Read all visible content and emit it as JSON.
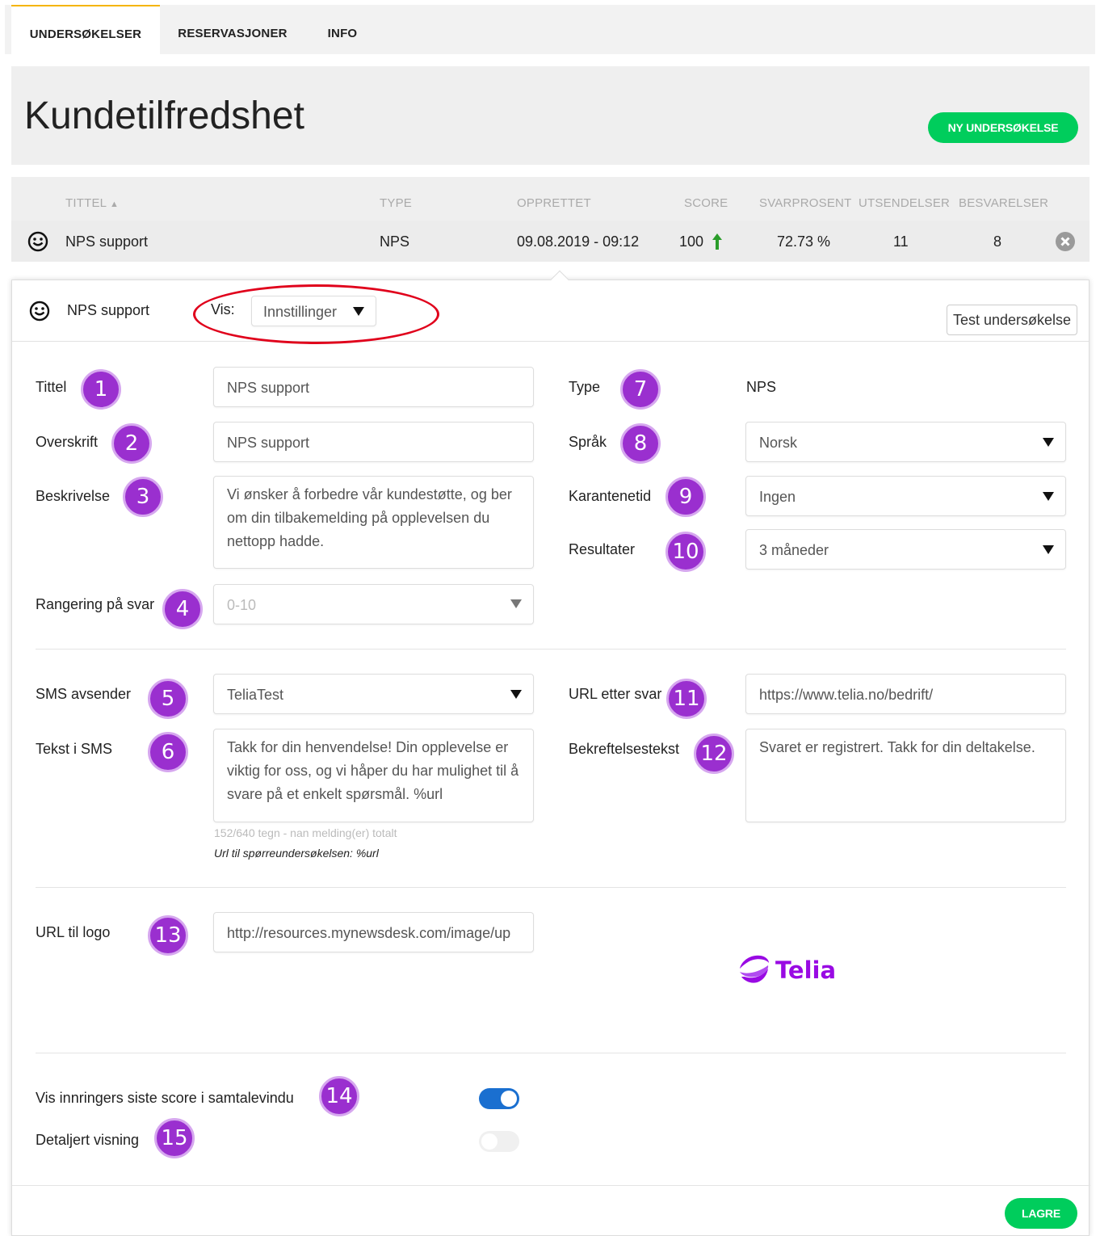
{
  "tabs": [
    {
      "label": "UNDERSØKELSER",
      "active": true
    },
    {
      "label": "RESERVASJONER",
      "active": false
    },
    {
      "label": "INFO",
      "active": false
    }
  ],
  "header": {
    "title": "Kundetilfredshet",
    "new_button": "NY UNDERSØKELSE"
  },
  "table": {
    "columns": [
      "TITTEL",
      "TYPE",
      "OPPRETTET",
      "SCORE",
      "SVARPROSENT",
      "UTSENDELSER",
      "BESVARELSER"
    ],
    "row": {
      "title": "NPS support",
      "type": "NPS",
      "created": "09.08.2019 - 09:12",
      "score": "100",
      "response_rate": "72.73 %",
      "sent": "11",
      "responses": "8"
    }
  },
  "panel": {
    "title": "NPS support",
    "vis_label": "Vis:",
    "vis_value": "Innstillinger",
    "test_button": "Test undersøkelse",
    "fields": {
      "tittel_label": "Tittel",
      "tittel_value": "NPS support",
      "overskrift_label": "Overskrift",
      "overskrift_value": "NPS support",
      "beskrivelse_label": "Beskrivelse",
      "beskrivelse_value": "Vi ønsker å forbedre vår kundestøtte, og ber om din tilbakemelding på opplevelsen du nettopp hadde.",
      "rangering_label": "Rangering på svar",
      "rangering_value": "0-10",
      "type_label": "Type",
      "type_value": "NPS",
      "sprak_label": "Språk",
      "sprak_value": "Norsk",
      "karantene_label": "Karantenetid",
      "karantene_value": "Ingen",
      "resultater_label": "Resultater",
      "resultater_value": "3 måneder",
      "sms_avsender_label": "SMS avsender",
      "sms_avsender_value": "TeliaTest",
      "tekst_sms_label": "Tekst i SMS",
      "tekst_sms_value": "Takk for din henvendelse! Din opplevelse er viktig for oss, og vi håper du har mulighet til å svare på et enkelt spørsmål. %url",
      "sms_counter": "152/640 tegn - nan melding(er) totalt",
      "sms_url_hint": "Url til spørreundersøkelsen: %url",
      "url_etter_label": "URL etter svar",
      "url_etter_value": "https://www.telia.no/bedrift/",
      "bekreft_label": "Bekreftelsestekst",
      "bekreft_value": "Svaret er registrert. Takk for din deltakelse.",
      "logo_label": "URL til logo",
      "logo_value": "http://resources.mynewsdesk.com/image/up",
      "logo_text": "Telia",
      "vis_score_label": "Vis innringers siste score i samtalevindu",
      "vis_score_on": true,
      "detaljert_label": "Detaljert visning",
      "detaljert_on": false
    },
    "save_button": "LAGRE"
  },
  "badges": [
    "1",
    "2",
    "3",
    "4",
    "5",
    "6",
    "7",
    "8",
    "9",
    "10",
    "11",
    "12",
    "13",
    "14",
    "15"
  ],
  "colors": {
    "accent_green": "#00cd5c",
    "tab_active": "#f5b400",
    "badge_purple": "#9a2fcf",
    "toggle_on": "#1a6fd0",
    "telia_purple": "#990ae3",
    "annotation_red": "#e0001b"
  }
}
